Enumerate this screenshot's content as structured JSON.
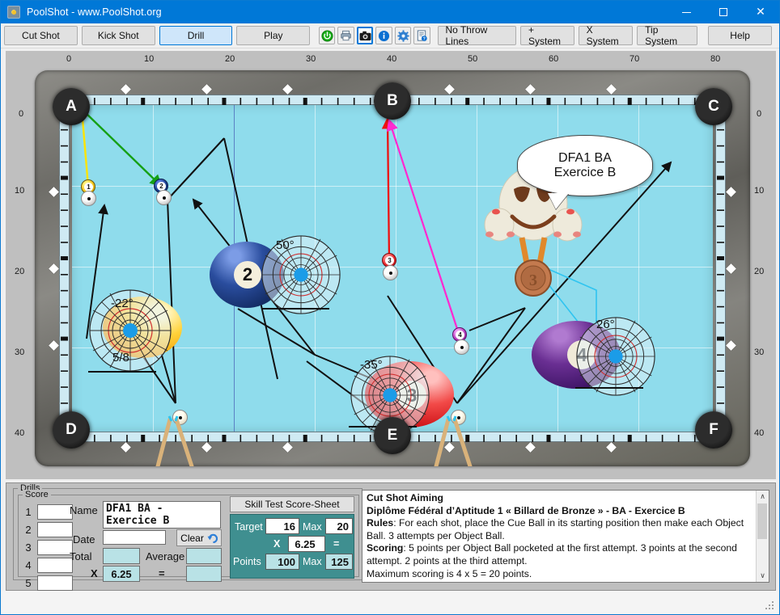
{
  "window": {
    "title": "PoolShot - www.PoolShot.org",
    "icon": "app-icon",
    "minimize": "–",
    "maximize": "□",
    "close": "✕"
  },
  "toolbar": {
    "tabs": [
      {
        "label": "Cut Shot",
        "active": false
      },
      {
        "label": "Kick Shot",
        "active": false
      },
      {
        "label": "Drill",
        "active": true
      },
      {
        "label": "Play",
        "active": false
      }
    ],
    "icons": [
      {
        "name": "power-icon",
        "glyph": "⏻",
        "color": "#1aa01a",
        "selected": false
      },
      {
        "name": "printer-icon",
        "glyph": "⎙",
        "color": "#4a6a8a",
        "selected": false
      },
      {
        "name": "camera-icon",
        "glyph": "◉",
        "color": "#111111",
        "selected": true
      },
      {
        "name": "info-icon",
        "glyph": "i",
        "color": "#0b6fd1",
        "selected": false
      },
      {
        "name": "settings-gear-icon",
        "glyph": "⚙",
        "color": "#2f7fd0",
        "selected": false
      },
      {
        "name": "help-document-icon",
        "glyph": "☷",
        "color": "#3a6ea5",
        "selected": false
      }
    ],
    "systems": [
      {
        "label": "No Throw Lines"
      },
      {
        "label": "+ System"
      },
      {
        "label": "X System"
      },
      {
        "label": "Tip System"
      },
      {
        "label": "Help"
      }
    ]
  },
  "table": {
    "ruler_top": [
      "0",
      "10",
      "20",
      "30",
      "40",
      "50",
      "60",
      "70",
      "80"
    ],
    "ruler_left": [
      "0",
      "10",
      "20",
      "30",
      "40"
    ],
    "ruler_right": [
      "0",
      "10",
      "20",
      "30",
      "40"
    ],
    "pockets": [
      {
        "label": "A",
        "name": "pocket-a"
      },
      {
        "label": "B",
        "name": "pocket-b"
      },
      {
        "label": "C",
        "name": "pocket-c"
      },
      {
        "label": "D",
        "name": "pocket-d"
      },
      {
        "label": "E",
        "name": "pocket-e"
      },
      {
        "label": "F",
        "name": "pocket-f"
      }
    ],
    "balls": [
      {
        "num": "1",
        "color": "#f4c41a",
        "kind": "solid-small"
      },
      {
        "num": "2",
        "color": "#1a3f8f",
        "kind": "solid-small"
      },
      {
        "num": "2",
        "color": "#24408f",
        "kind": "solid-big",
        "angle": "50°"
      },
      {
        "num": "",
        "color": "#f5b01a",
        "kind": "solid-big",
        "angle": "-22°",
        "fraction": "5/8"
      },
      {
        "num": "3",
        "color": "#e8282d",
        "kind": "solid-small"
      },
      {
        "num": "3",
        "color": "#e8282d",
        "kind": "solid-big",
        "angle": "-35°"
      },
      {
        "num": "4",
        "color": "#b83fbf",
        "kind": "solid-small"
      },
      {
        "num": "4",
        "color": "#5a2a7a",
        "kind": "solid-big",
        "angle": "26°"
      }
    ],
    "speech_bubble": {
      "line1": "DFA1 BA",
      "line2": "Exercice B"
    },
    "mascot": {
      "name": "poolshot-mascot",
      "medal": "3"
    },
    "felt_color": "#8fdcec",
    "cue_color": "#d9b27a",
    "lines": {
      "yellow": "#ffe400",
      "green": "#15a015",
      "red": "#ee1111",
      "magenta": "#ff2bd0",
      "black": "#111111",
      "cyan_guide": "#2fc4f0"
    }
  },
  "drills": {
    "group_label": "Drills",
    "score": {
      "group_label": "Score",
      "rows": [
        "1",
        "2",
        "3",
        "4",
        "5"
      ],
      "values": [
        "",
        "",
        "",
        "",
        ""
      ],
      "name_label": "Name",
      "name_value": "DFA1 BA - Exercice B",
      "date_label": "Date",
      "date_value": "",
      "clear_label": "Clear",
      "clear_icon": "undo-arrow-icon",
      "total_label": "Total",
      "total_value": "",
      "average_label": "Average",
      "average_value": "",
      "multiply_label": "X",
      "multiplier_value": "6.25",
      "equals_label": "=",
      "result_value": ""
    },
    "skill_test": {
      "header": "Skill Test Score-Sheet",
      "target_label": "Target",
      "target_value": "16",
      "target_max_label": "Max",
      "target_max_value": "20",
      "multiply_label": "X",
      "multiplier_value": "6.25",
      "equals_label": "=",
      "points_label": "Points",
      "points_value": "100",
      "points_max_label": "Max",
      "points_max_value": "125",
      "panel_color": "#3f8f90"
    },
    "description": {
      "title": "Cut Shot Aiming",
      "subtitle": "Diplôme Fédéral d’Aptitude 1 « Billard de Bronze » - BA - Exercice B",
      "rules_label": "Rules",
      "rules_text": ": For each shot, place the Cue Ball in its starting position then make each Object Ball. 3 attempts per Object Ball.",
      "scoring_label": "Scoring",
      "scoring_text": ": 5 points per Object Ball pocketed at the first attempt. 3 points at the second attempt. 2 points at the third attempt.",
      "max_text": "Maximum scoring is 4 x 5 = 20 points.",
      "scroll_up": "∧",
      "scroll_down": "∨"
    }
  }
}
